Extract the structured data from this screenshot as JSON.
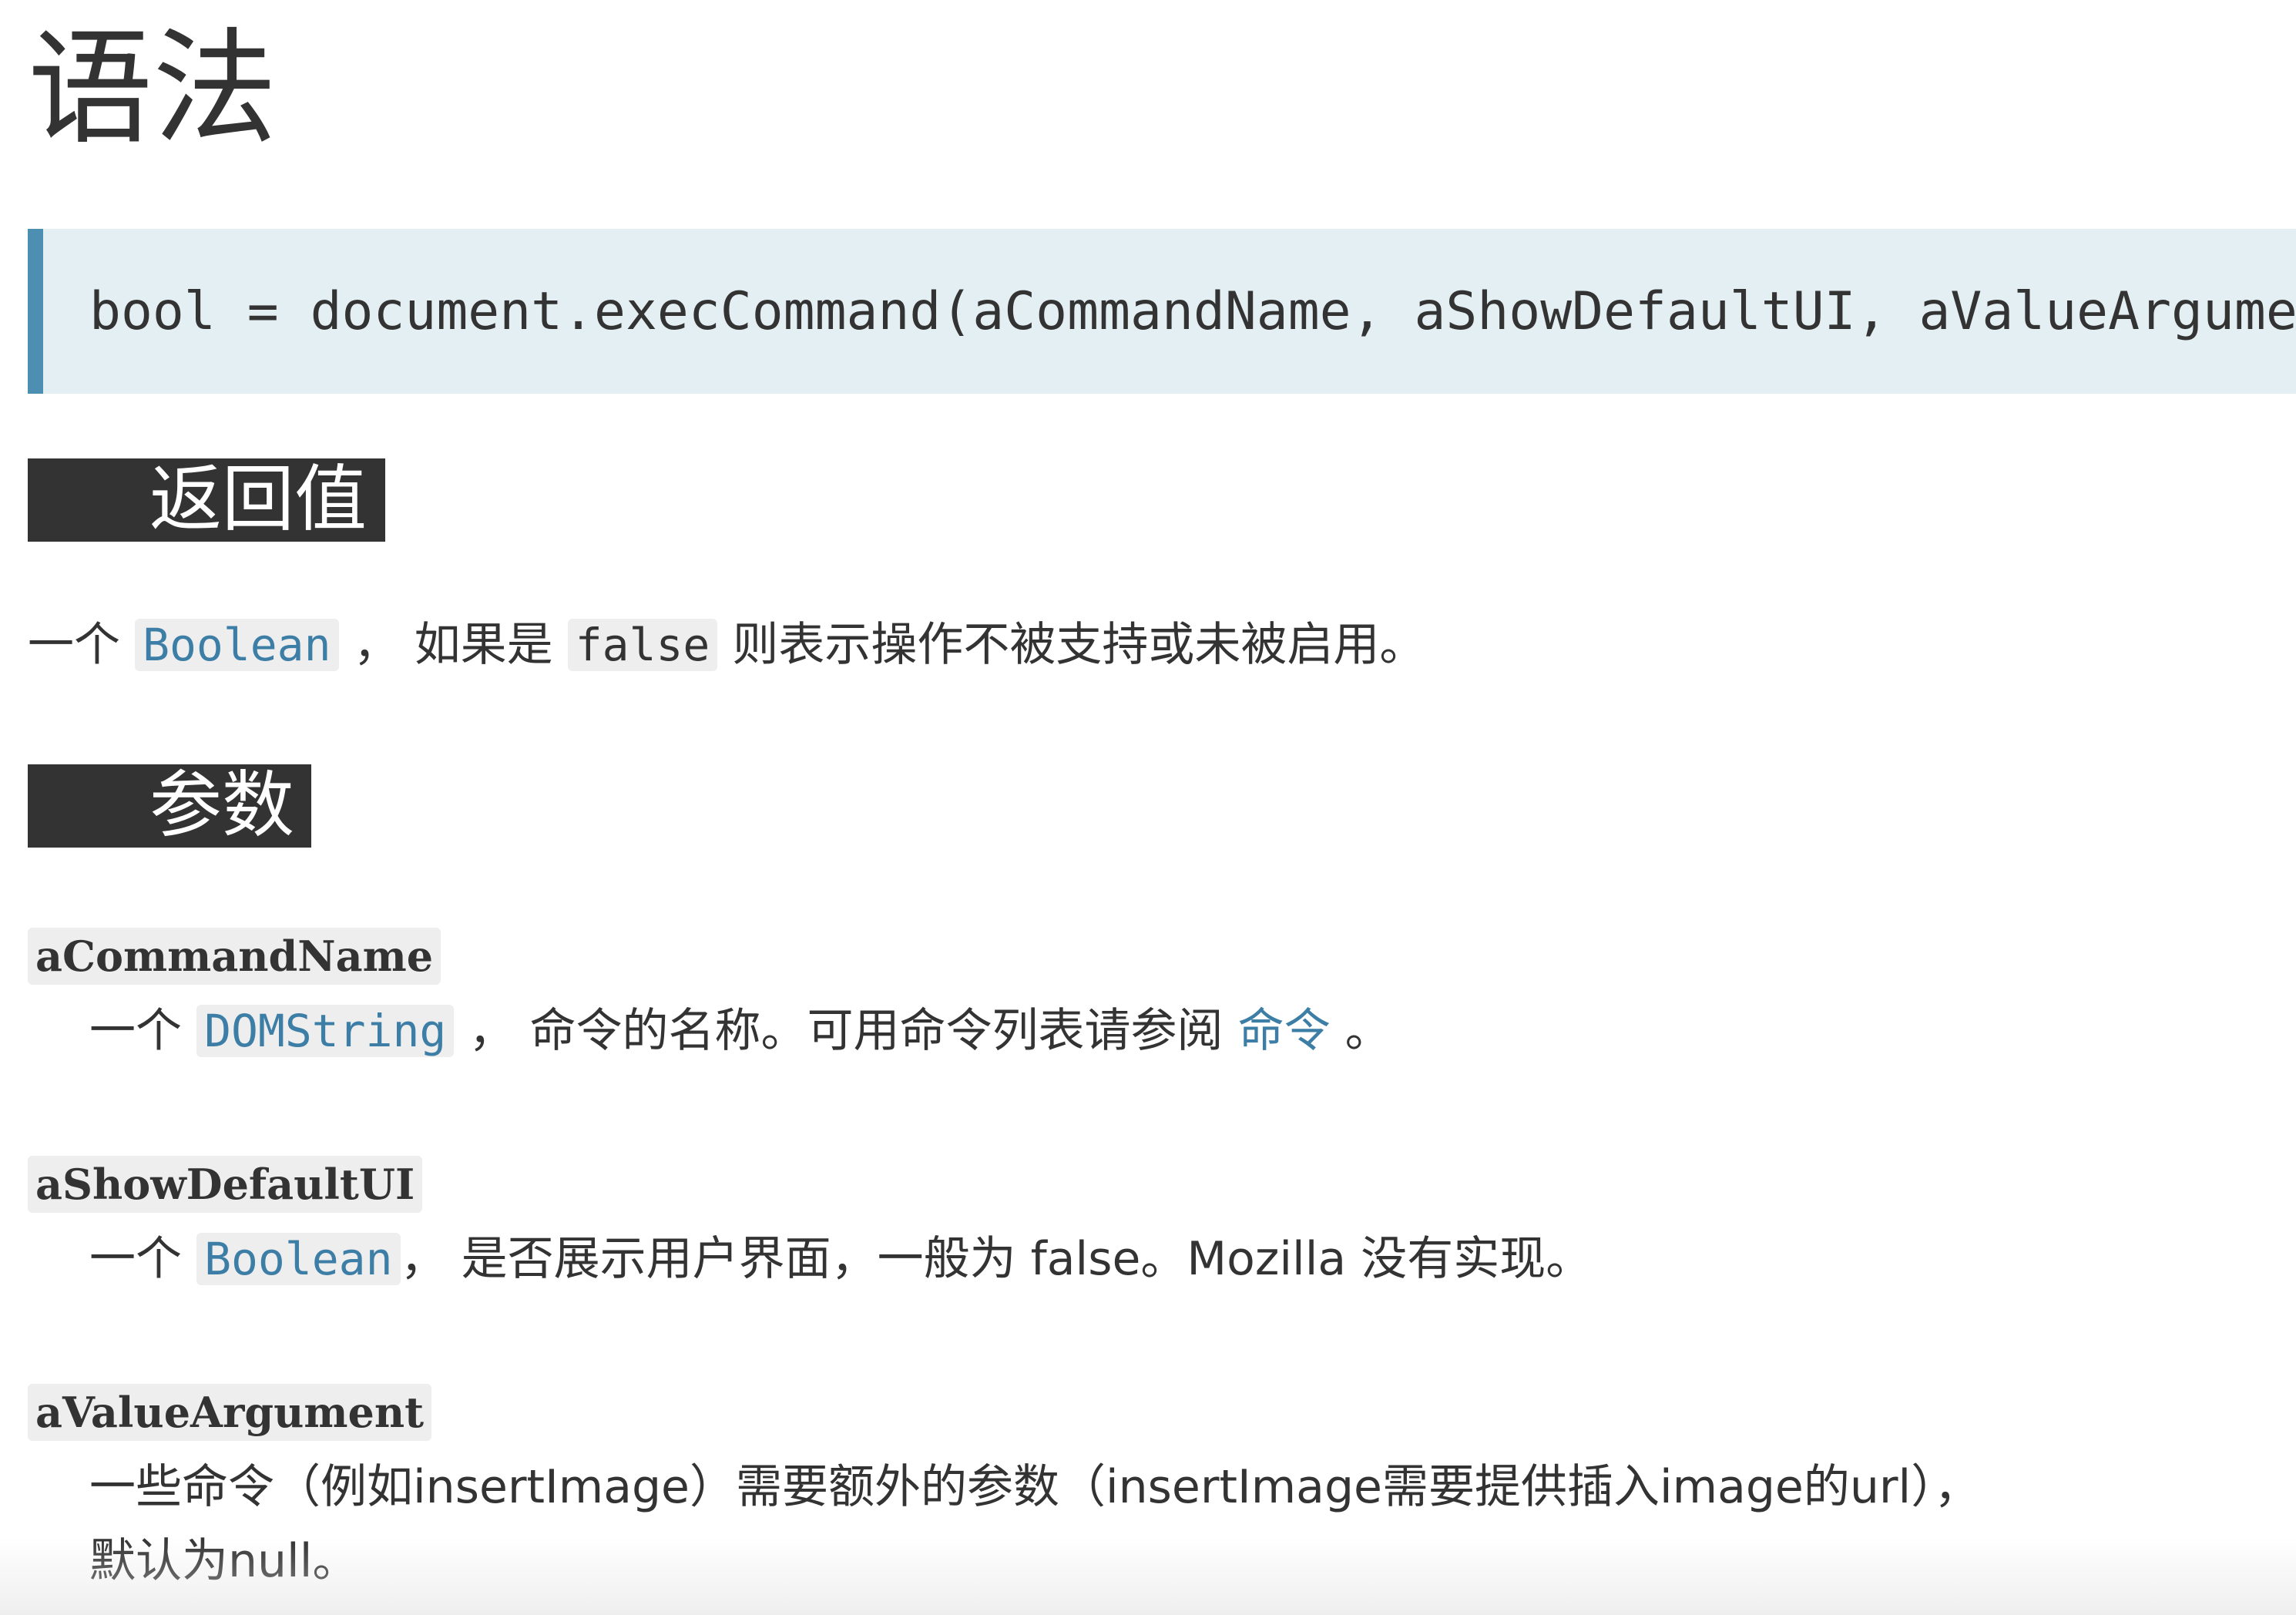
{
  "heading_syntax": "语法",
  "syntax_code": "bool = document.execCommand(aCommandName, aShowDefaultUI, aValueArgument)",
  "returns": {
    "heading": "返回值",
    "text_before": "一个 ",
    "type_link": "Boolean",
    "text_mid": " ， 如果是 ",
    "false_code": "false",
    "text_after": " 则表示操作不被支持或未被启用。"
  },
  "params": {
    "heading": "参数",
    "items": [
      {
        "name": "aCommandName",
        "desc_before": "一个 ",
        "type_link": "DOMString",
        "desc_mid": " ， 命令的名称。可用命令列表请参阅 ",
        "link": "命令",
        "desc_after": " 。"
      },
      {
        "name": "aShowDefaultUI",
        "desc_before": "一个 ",
        "type_link": "Boolean",
        "desc_after": "， 是否展示用户界面，一般为 false。Mozilla 没有实现。"
      },
      {
        "name": "aValueArgument",
        "desc_line1": "一些命令（例如insertImage）需要额外的参数（insertImage需要提供插入image的url），",
        "desc_line2": "默认为null。"
      }
    ]
  }
}
